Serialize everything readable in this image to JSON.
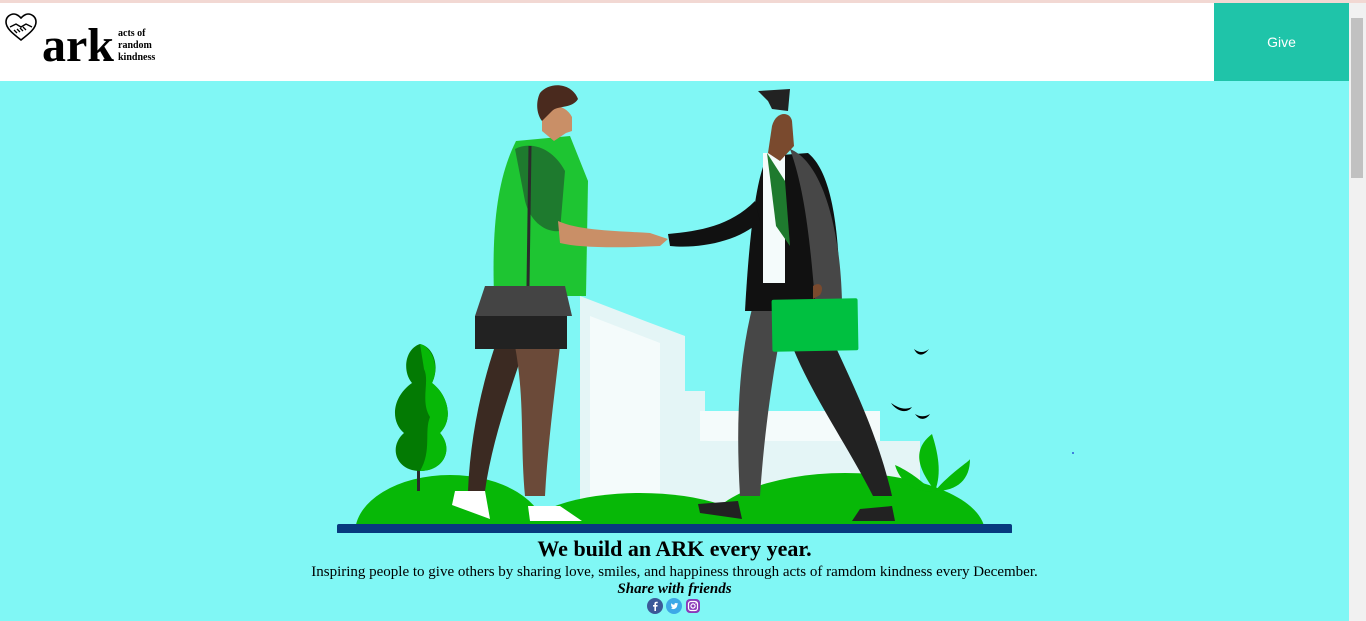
{
  "brand": {
    "name": "ark",
    "tagline_lines": [
      "acts of",
      "random",
      "kindness"
    ]
  },
  "nav": {
    "give_label": "Give"
  },
  "hero": {
    "headline": "We build an ARK every year.",
    "subtitle": "Inspiring people to give others by sharing love, smiles, and happiness through acts of ramdom kindness every December.",
    "share_label": "Share with friends"
  },
  "social_icons": [
    "facebook-icon",
    "twitter-icon",
    "instagram-icon"
  ],
  "colors": {
    "hero_bg": "#80f7f5",
    "accent": "#1fc4a9",
    "green": "#1ec532"
  }
}
